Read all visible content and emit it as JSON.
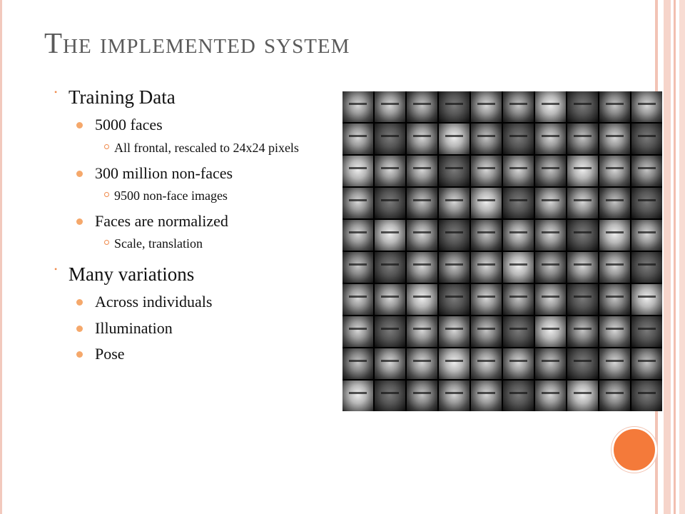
{
  "slide": {
    "title": "The implemented system",
    "accent_color": "#f47a3a",
    "bullets": [
      {
        "label": "Training Data",
        "items": [
          {
            "label": "5000 faces",
            "subitems": [
              "All frontal, rescaled to 24x24 pixels"
            ]
          },
          {
            "label": "300 million non-faces",
            "subitems": [
              "9500 non-face images"
            ]
          },
          {
            "label": "Faces are normalized",
            "subitems": [
              "Scale, translation"
            ]
          }
        ]
      },
      {
        "label": "Many variations",
        "items": [
          {
            "label": "Across individuals",
            "subitems": []
          },
          {
            "label": "Illumination",
            "subitems": []
          },
          {
            "label": "Pose",
            "subitems": []
          }
        ]
      }
    ],
    "image": {
      "description_icon": "face-photo-grid",
      "rows": 10,
      "cols": 10
    }
  }
}
